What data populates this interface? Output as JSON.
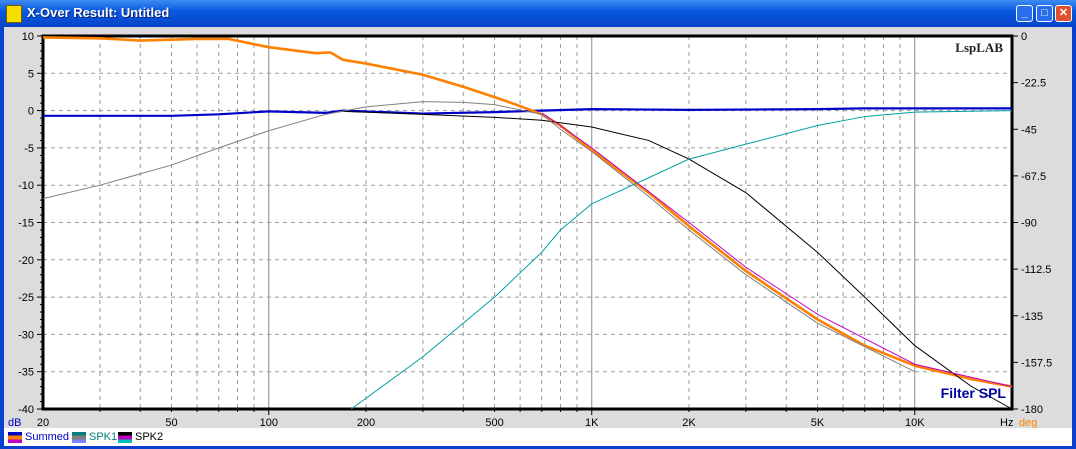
{
  "window": {
    "title": "X-Over Result: Untitled",
    "buttons": [
      "minimize",
      "maximize",
      "close"
    ]
  },
  "watermark": "LspLAB",
  "chart_label": "Filter SPL",
  "colors": {
    "summed": "#0000c8",
    "phase": "#ff8000",
    "spk1": "#000000",
    "spk1_b": "#808080",
    "spk2_a": "#c000c0",
    "spk2_b": "#00a0a0"
  },
  "chart_data": {
    "type": "line",
    "title": "Filter SPL",
    "xlabel": "Hz",
    "ylabel": "dB",
    "y2label": "deg",
    "xscale": "log",
    "xlim": [
      20,
      20000
    ],
    "ylim": [
      -40,
      10
    ],
    "y2lim": [
      -180,
      0
    ],
    "xticks": [
      "20",
      "50",
      "100",
      "200",
      "500",
      "1K",
      "2K",
      "5K",
      "10K"
    ],
    "xtick_values": [
      20,
      50,
      100,
      200,
      500,
      1000,
      2000,
      5000,
      10000
    ],
    "yticks": [
      "10",
      "5",
      "0",
      "-5",
      "-10",
      "-15",
      "-20",
      "-25",
      "-30",
      "-35",
      "-40"
    ],
    "y2ticks": [
      "0",
      "-22.5",
      "-45",
      "-67.5",
      "-90",
      "-112.5",
      "-135",
      "-157.5",
      "-180"
    ],
    "grid": true,
    "series": [
      {
        "name": "Summed SPL",
        "axis": "left",
        "color": "#0000c8",
        "width": 2.2,
        "x": [
          20,
          50,
          70,
          100,
          150,
          170,
          300,
          500,
          700,
          1000,
          2000,
          5000,
          7000,
          20000
        ],
        "y": [
          -0.7,
          -0.7,
          -0.5,
          -0.1,
          -0.3,
          0,
          -0.4,
          -0.2,
          0,
          0.2,
          0.1,
          0.2,
          0.3,
          0.3
        ]
      },
      {
        "name": "Summed phase",
        "axis": "right",
        "color": "#ff8000",
        "width": 2.6,
        "x": [
          20,
          30,
          40,
          60,
          75,
          100,
          140,
          155,
          170,
          200,
          300,
          400,
          500,
          600,
          700,
          800,
          1000,
          1500,
          2000,
          3000,
          5000,
          7000,
          10000,
          15000,
          20000
        ],
        "y": [
          -0.7,
          -1.1,
          -2.2,
          -1.4,
          -1.4,
          -5.4,
          -8.3,
          -7.9,
          -11.5,
          -13.3,
          -18.7,
          -24.5,
          -29.5,
          -33.8,
          -37.8,
          -43.2,
          -55.1,
          -75.6,
          -91.8,
          -113.4,
          -136.8,
          -149.4,
          -159.1,
          -165.6,
          -169.2
        ]
      },
      {
        "name": "SPK1 SPL",
        "axis": "left",
        "color": "#000000",
        "width": 1,
        "x": [
          170,
          300,
          500,
          700,
          1000,
          1500,
          2000,
          3000,
          5000,
          7000,
          10000,
          15000,
          20000
        ],
        "y": [
          -0.1,
          -0.5,
          -0.9,
          -1.3,
          -2.2,
          -4,
          -6.5,
          -11,
          -19,
          -25,
          -31.5,
          -37,
          -40
        ]
      },
      {
        "name": "SPK1 phase",
        "axis": "left",
        "color": "#808080",
        "width": 1,
        "x": [
          20,
          30,
          50,
          70,
          100,
          150,
          200,
          300,
          400,
          500,
          700,
          800,
          1000,
          1500,
          2000,
          3000,
          5000,
          10000
        ],
        "y": [
          -11.8,
          -10,
          -7.3,
          -5,
          -2.7,
          -0.5,
          0.5,
          1.2,
          1.1,
          0.8,
          -0.5,
          -2.5,
          -5.5,
          -11.5,
          -16,
          -22,
          -28.5,
          -35
        ]
      },
      {
        "name": "SPK2 SPL",
        "axis": "left",
        "color": "#c000c0",
        "width": 1,
        "x": [
          700,
          800,
          1000,
          2000,
          3000,
          5000,
          10000,
          20000
        ],
        "y": [
          -0.3,
          -2,
          -5,
          -15,
          -21,
          -27.3,
          -34,
          -37
        ]
      },
      {
        "name": "SPK2 phase",
        "axis": "left",
        "color": "#00a0a0",
        "width": 1,
        "x": [
          180,
          300,
          500,
          700,
          800,
          1000,
          1500,
          2000,
          3000,
          5000,
          7000,
          10000,
          20000
        ],
        "y": [
          -40,
          -33,
          -25,
          -19,
          -16,
          -12.5,
          -9,
          -6.5,
          -4.5,
          -2,
          -0.8,
          -0.2,
          0
        ]
      }
    ]
  },
  "legend": [
    {
      "label": "Summed",
      "colors": [
        "#0000c8",
        "#ff8000",
        "#c000c0"
      ],
      "text_color": "#0000c8"
    },
    {
      "label": "SPK1",
      "colors": [
        "#008080",
        "#808080",
        "#8080ff"
      ],
      "text_color": "#008080"
    },
    {
      "label": "SPK2",
      "colors": [
        "#000000",
        "#c000c0",
        "#00c0c0"
      ],
      "text_color": "#000000"
    }
  ]
}
